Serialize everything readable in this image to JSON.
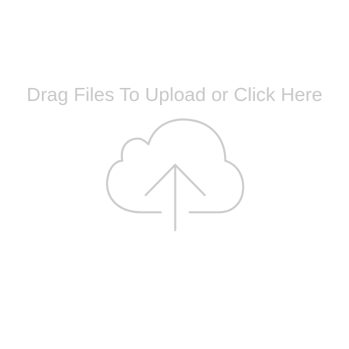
{
  "dropzone": {
    "prompt_text": "Drag Files To Upload or Click Here",
    "icon": "cloud-upload-icon",
    "icon_color": "#cccccc",
    "text_color": "#c8c8c8"
  }
}
